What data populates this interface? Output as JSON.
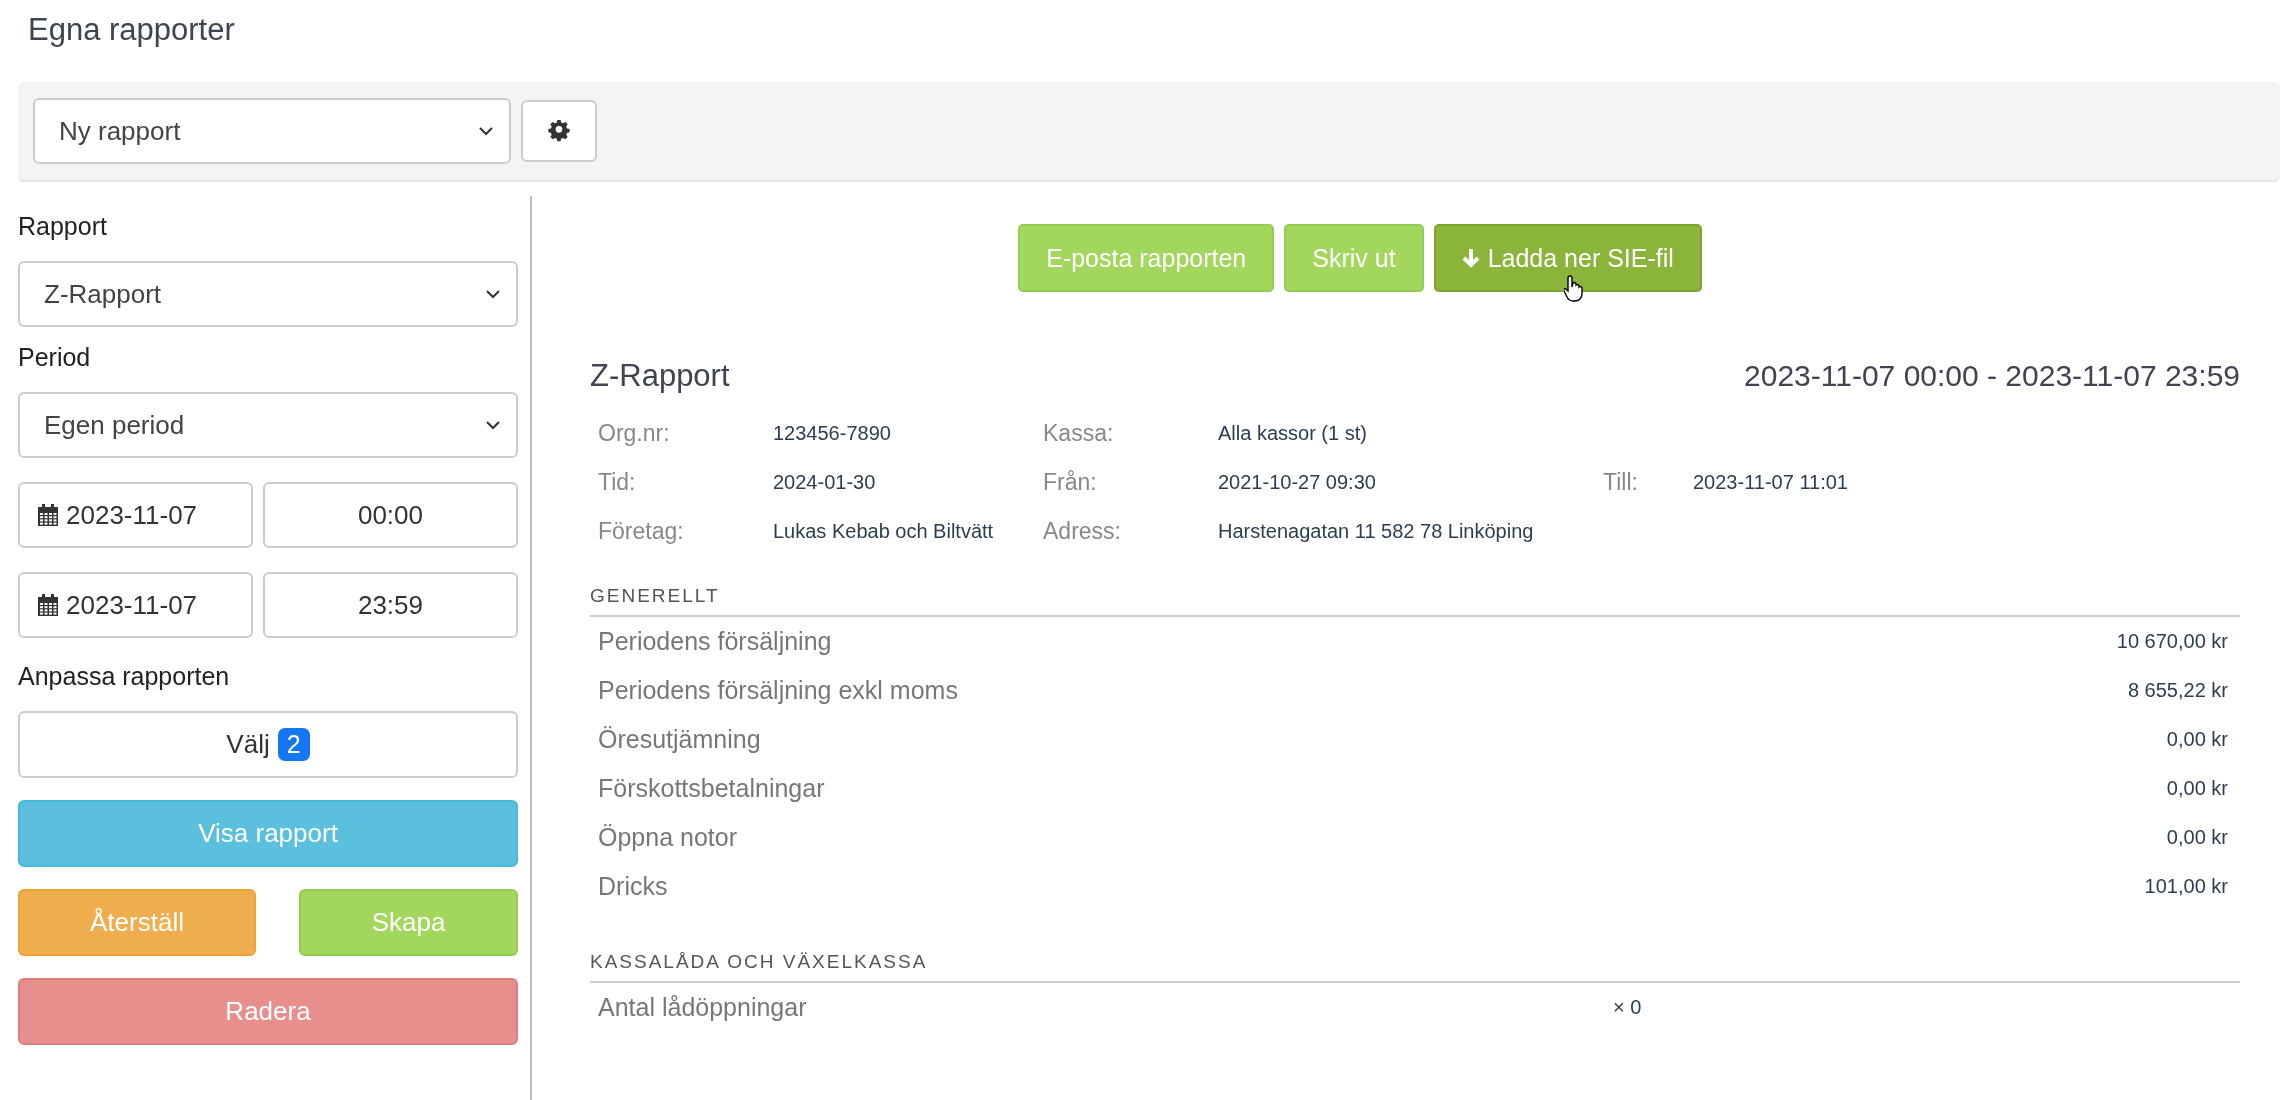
{
  "page_title": "Egna rapporter",
  "toolbar": {
    "report_select": "Ny rapport"
  },
  "sidebar": {
    "report_label": "Rapport",
    "report_select": "Z-Rapport",
    "period_label": "Period",
    "period_select": "Egen period",
    "ranges": [
      {
        "date": "2023-11-07",
        "time": "00:00"
      },
      {
        "date": "2023-11-07",
        "time": "23:59"
      }
    ],
    "customize_label": "Anpassa rapporten",
    "choose_button": "Välj",
    "choose_count": "2",
    "show_button": "Visa rapport",
    "reset_button": "Återställ",
    "create_button": "Skapa",
    "delete_button": "Radera"
  },
  "actions": [
    {
      "label": "E-posta rapporten",
      "kind": "plain",
      "selected": false
    },
    {
      "label": "Skriv ut",
      "kind": "plain",
      "selected": false
    },
    {
      "label": "Ladda ner SIE-fil",
      "kind": "download",
      "selected": true
    }
  ],
  "report": {
    "title": "Z-Rapport",
    "period": "2023-11-07 00:00 - 2023-11-07 23:59",
    "info": [
      [
        {
          "label": "Org.nr:",
          "value": "123456-7890"
        },
        {
          "label": "Kassa:",
          "value": "Alla kassor (1 st)"
        }
      ],
      [
        {
          "label": "Tid:",
          "value": "2024-01-30"
        },
        {
          "label": "Från:",
          "value": "2021-10-27 09:30"
        },
        {
          "label": "Till:",
          "value": "2023-11-07 11:01"
        }
      ],
      [
        {
          "label": "Företag:",
          "value": "Lukas Kebab och Biltvätt"
        },
        {
          "label": "Adress:",
          "value": "Harstenagatan 11 582 78 Linköping"
        }
      ]
    ],
    "sections": [
      {
        "title": "GENERELLT",
        "kind": "amount",
        "rows": [
          {
            "label": "Periodens försäljning",
            "value": "10 670,00 kr"
          },
          {
            "label": "Periodens försäljning exkl moms",
            "value": "8 655,22 kr"
          },
          {
            "label": "Öresutjämning",
            "value": "0,00 kr"
          },
          {
            "label": "Förskottsbetalningar",
            "value": "0,00 kr"
          },
          {
            "label": "Öppna notor",
            "value": "0,00 kr"
          },
          {
            "label": "Dricks",
            "value": "101,00 kr"
          }
        ]
      },
      {
        "title": "KASSALÅDA OCH VÄXELKASSA",
        "kind": "count",
        "rows": [
          {
            "label": "Antal lådöppningar",
            "value": "× 0"
          }
        ]
      }
    ]
  }
}
